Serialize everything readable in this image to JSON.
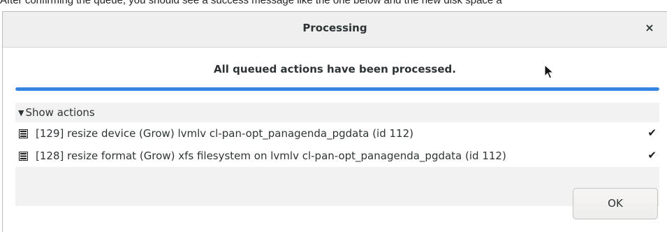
{
  "document": {
    "background_text": "After confirming the queue, you should see a success message like the one below and the new disk space a"
  },
  "dialog": {
    "title": "Processing",
    "close_glyph": "×",
    "status_text": "All queued actions have been processed.",
    "progress_percent": 100,
    "accent_color": "#3584e4",
    "expander": {
      "arrow": "▼",
      "label": "Show actions",
      "expanded": true
    },
    "actions": [
      {
        "text": "[129] resize device (Grow) lvmlv cl-pan-opt_panagenda_pgdata (id 112)",
        "icon": "action-queue-icon",
        "status_glyph": "✔"
      },
      {
        "text": "[128] resize format (Grow) xfs filesystem on lvmlv cl-pan-opt_panagenda_pgdata (id 112)",
        "icon": "action-queue-icon",
        "status_glyph": "✔"
      }
    ],
    "ok_label": "OK"
  }
}
